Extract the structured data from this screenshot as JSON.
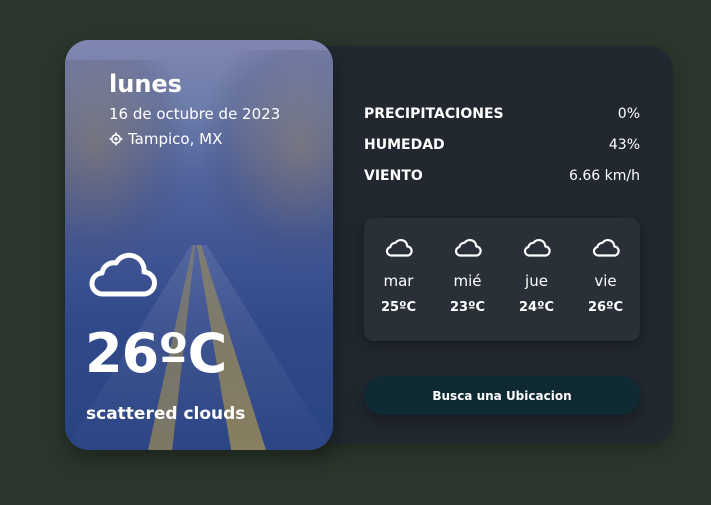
{
  "hero": {
    "day": "lunes",
    "date": "16 de octubre de 2023",
    "location": "Tampico, MX",
    "location_icon": "location-target-icon",
    "weather_icon": "cloud-icon",
    "temperature": "26ºC",
    "description": "scattered clouds"
  },
  "stats": [
    {
      "label": "PRECIPITACIONES",
      "value": "0%"
    },
    {
      "label": "HUMEDAD",
      "value": "43%"
    },
    {
      "label": "VIENTO",
      "value": "6.66 km/h"
    }
  ],
  "forecast": [
    {
      "day": "mar",
      "temp": "25ºC",
      "icon": "cloud-icon"
    },
    {
      "day": "mié",
      "temp": "23ºC",
      "icon": "cloud-icon"
    },
    {
      "day": "jue",
      "temp": "24ºC",
      "icon": "cloud-icon"
    },
    {
      "day": "vie",
      "temp": "26ºC",
      "icon": "cloud-icon"
    }
  ],
  "search_button": {
    "label": "Busca una Ubicacion"
  },
  "colors": {
    "page_background": "#2b372c",
    "panel_background": "#222830",
    "forecast_background": "#2a3038",
    "button_background": "#0f2a33",
    "text": "#ffffff"
  }
}
